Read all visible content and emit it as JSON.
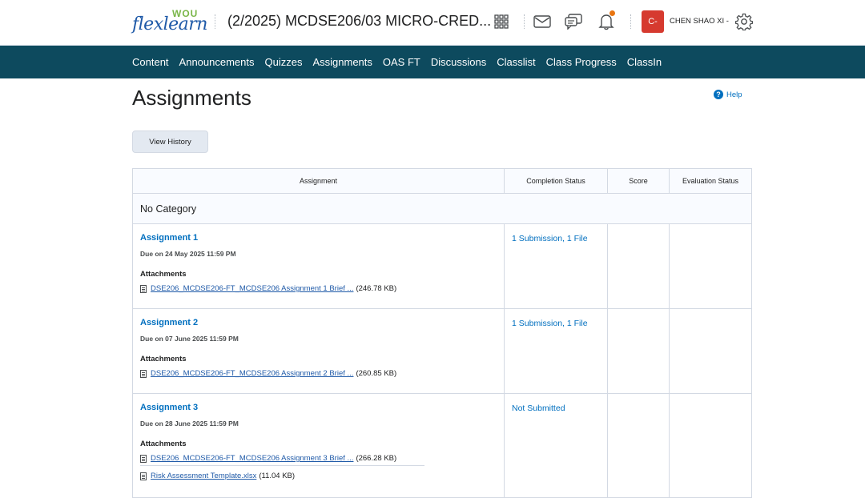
{
  "header": {
    "logo_main": "flexlearn",
    "logo_tag": "WOU",
    "course_title": "(2/2025) MCDSE206/03 MICRO-CRED...",
    "user_initials": "C-",
    "user_name": "CHEN SHAO XI -",
    "icons": [
      "apps-grid-icon",
      "mail-icon",
      "chat-icon",
      "bell-icon",
      "gear-icon"
    ],
    "notification_color": "#e87511"
  },
  "nav": {
    "items": [
      "Content",
      "Announcements",
      "Quizzes",
      "Assignments",
      "OAS FT",
      "Discussions",
      "Classlist",
      "Class Progress",
      "ClassIn"
    ],
    "bg_color": "#0d4a5e"
  },
  "page": {
    "title": "Assignments",
    "help_label": "Help",
    "view_history_label": "View History"
  },
  "table": {
    "headers": [
      "Assignment",
      "Completion Status",
      "Score",
      "Evaluation Status"
    ],
    "category": "No Category",
    "attachments_label": "Attachments",
    "rows": [
      {
        "title": "Assignment 1",
        "due": "Due on 24 May 2025 11:59 PM",
        "status": "1 Submission, 1 File",
        "files": [
          {
            "name": "DSE206_MCDSE206-FT_MCDSE206 Assignment 1 Brief ...",
            "size": "(246.78 KB)"
          }
        ]
      },
      {
        "title": "Assignment 2",
        "due": "Due on 07 June 2025 11:59 PM",
        "status": "1 Submission, 1 File",
        "files": [
          {
            "name": "DSE206_MCDSE206-FT_MCDSE206 Assignment 2 Brief ...",
            "size": "(260.85 KB)"
          }
        ]
      },
      {
        "title": "Assignment 3",
        "due": "Due on 28 June 2025 11:59 PM",
        "status": "Not Submitted",
        "files": [
          {
            "name": "DSE206_MCDSE206-FT_MCDSE206 Assignment 3 Brief ...",
            "size": "(266.28 KB)"
          },
          {
            "name": "Risk Assessment Template.xlsx",
            "size": "(11.04 KB)"
          }
        ]
      }
    ]
  }
}
